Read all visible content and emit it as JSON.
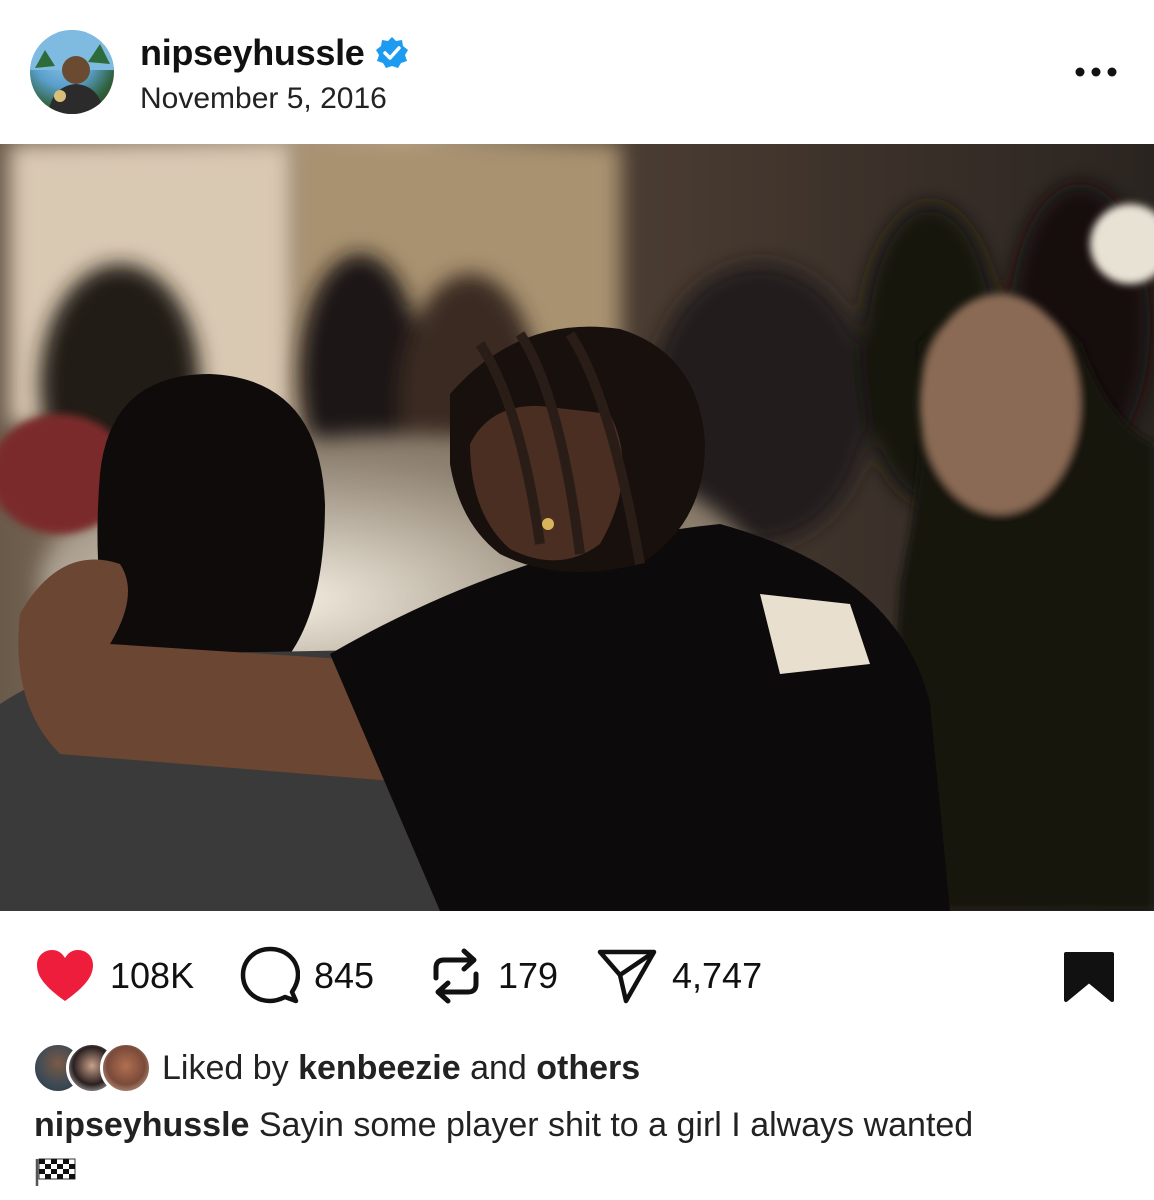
{
  "post": {
    "username": "nipseyhussle",
    "date": "November 5, 2016",
    "verified": true,
    "image_alt": "Photo of people seated at a dinner table; a man with braids has his arm around a woman",
    "actions": {
      "likes": "108K",
      "comments": "845",
      "reposts": "179",
      "shares": "4,747"
    },
    "liked_by": {
      "prefix": "Liked by",
      "user": "kenbeezie",
      "conjunction": "and",
      "others": "others"
    },
    "caption": {
      "username": "nipseyhussle",
      "text": "Sayin some player shit to a girl I always wanted"
    }
  },
  "colors": {
    "like": "#ee1d3b",
    "verified": "#1d9bf0",
    "text": "#111111"
  },
  "icons": [
    "heart-icon",
    "comment-icon",
    "repost-icon",
    "share-icon",
    "bookmark-icon",
    "more-icon",
    "checkered-flag-icon",
    "verified-icon"
  ]
}
